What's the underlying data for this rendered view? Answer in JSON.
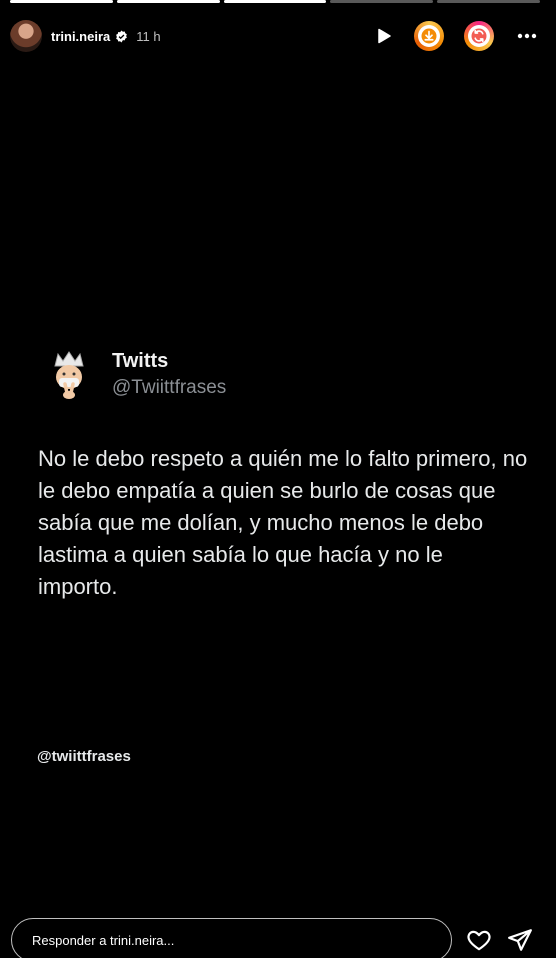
{
  "story": {
    "progress": [
      1,
      1,
      1,
      0,
      0
    ],
    "author": {
      "username": "trini.neira",
      "time": "11 h",
      "verified": true
    },
    "actions": [
      "play-icon",
      "download-icon",
      "sync-icon",
      "more-icon"
    ]
  },
  "tweet": {
    "name": "Twitts",
    "handle": "@Twiittfrases",
    "text": "No le debo respeto a quién me lo falto primero, no le debo empatía a quien se burlo de cosas que sabía que me dolían, y mucho menos le debo lastima a quien sabía lo que hacía y no le importo.",
    "watermark": "@twiittfrases"
  },
  "reply": {
    "placeholder": "Responder a trini.neira..."
  },
  "colors": {
    "background": "#000000",
    "text": "#e7e9ea",
    "handle": "#8b8f94"
  }
}
